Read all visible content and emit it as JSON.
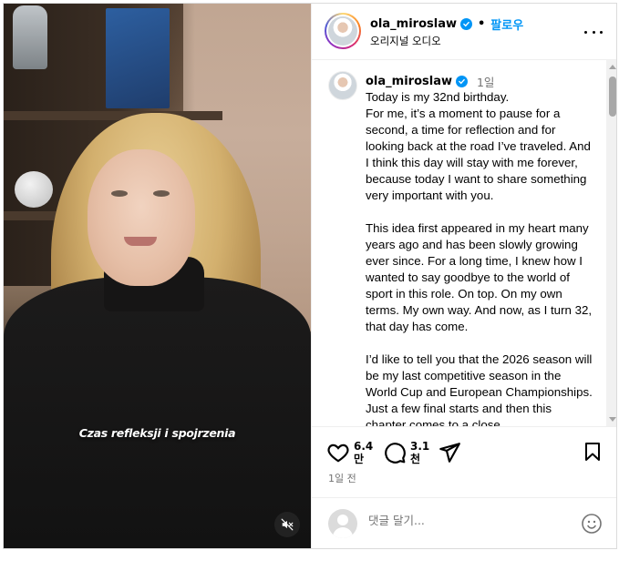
{
  "video": {
    "subtitle": "Czas refleksji i spojrzenia",
    "mute_icon": "muted-speaker-icon"
  },
  "header": {
    "username": "ola_miroslaw",
    "separator": "•",
    "follow_label": "팔로우",
    "audio_label": "오리지널 오디오"
  },
  "post": {
    "username": "ola_miroslaw",
    "time_ago": "1일",
    "paragraphs": [
      "Today is my 32nd birthday.\nFor me, it’s a moment to pause for a second, a time for reflection and for looking back at the road I’ve traveled. And I think this day will stay with me forever, because today I want to share something very important with you.",
      "This idea first appeared in my heart many years ago and has been slowly growing ever since. For a long time, I knew how I wanted to say goodbye to the world of sport in this role. On top. On my own terms. My own way. And now, as I turn 32, that day has come.",
      "I’d like to tell you that the 2026 season will be my last competitive season in the World Cup and European Championships. Just a few final starts and then this chapter comes to a close."
    ]
  },
  "actions": {
    "likes": "6.4\n만",
    "comments": "3.1\n천",
    "post_age": "1일 전"
  },
  "comment_box": {
    "placeholder": "댓글 달기..."
  },
  "colors": {
    "accent_blue": "#0095f6",
    "muted_text": "#737373",
    "border": "#dbdbdb"
  }
}
